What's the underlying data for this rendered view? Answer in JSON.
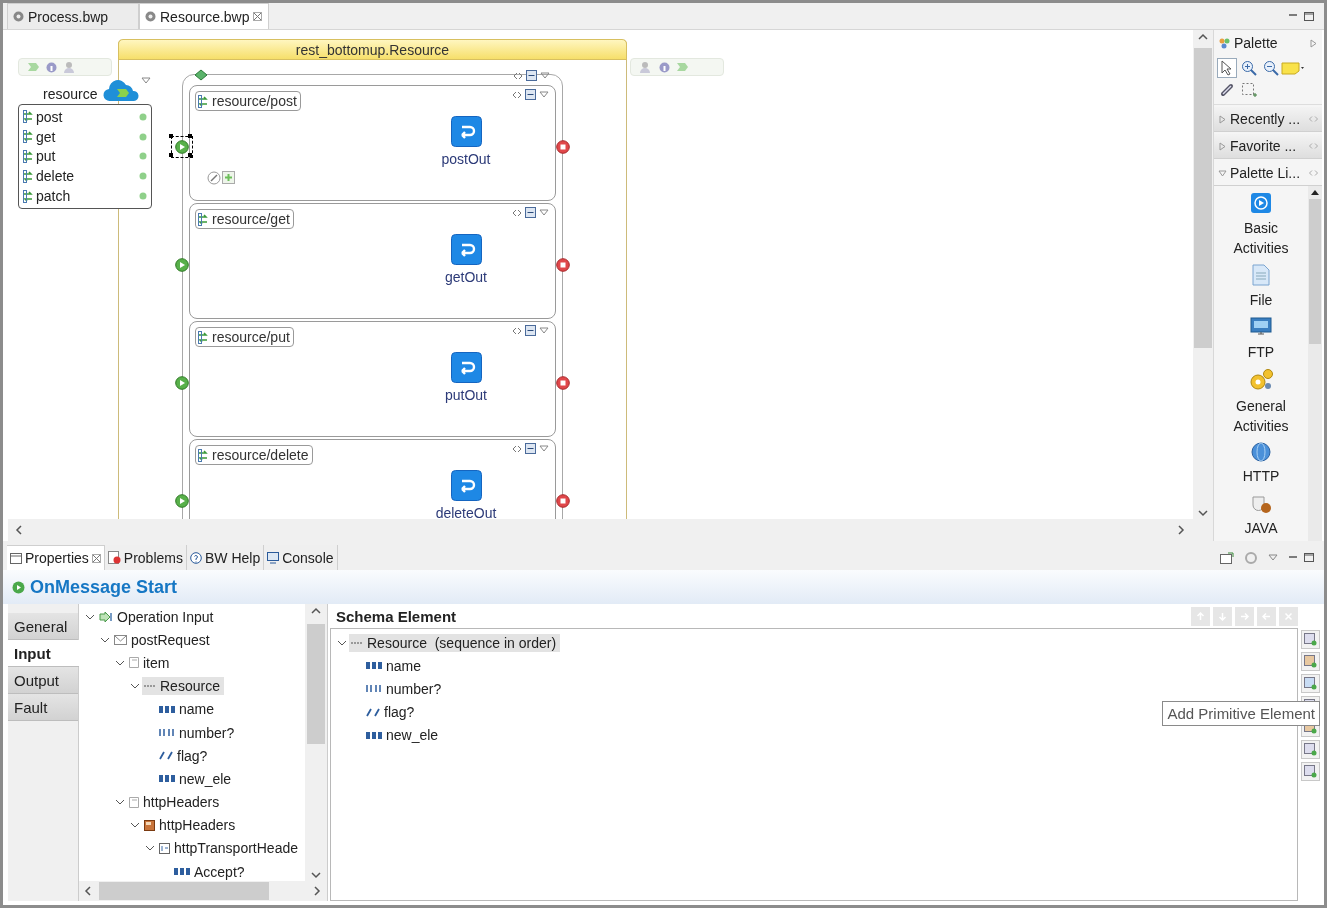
{
  "editor": {
    "tabs": [
      {
        "label": "Process.bwp",
        "selected": false,
        "closable": false
      },
      {
        "label": "Resource.bwp",
        "selected": true,
        "closable": true
      }
    ]
  },
  "canvas": {
    "resource": {
      "label": "resource",
      "operations": [
        "post",
        "get",
        "put",
        "delete",
        "patch"
      ]
    },
    "process": {
      "title": "rest_bottomup.Resource",
      "scopes": [
        {
          "label": "resource/post",
          "reply": "postOut",
          "start_selected": true
        },
        {
          "label": "resource/get",
          "reply": "getOut",
          "start_selected": false
        },
        {
          "label": "resource/put",
          "reply": "putOut",
          "start_selected": false
        },
        {
          "label": "resource/delete",
          "reply": "deleteOut",
          "start_selected": false
        }
      ]
    }
  },
  "palette": {
    "title": "Palette",
    "tools": [
      {
        "kind": "select",
        "selected": true
      },
      {
        "kind": "zoom_in",
        "selected": false
      },
      {
        "kind": "zoom_out",
        "selected": false
      },
      {
        "kind": "note",
        "selected": false
      },
      {
        "kind": "link",
        "selected": false
      },
      {
        "kind": "marquee",
        "selected": false
      }
    ],
    "drawers": [
      {
        "label": "Recently ...",
        "expanded": false
      },
      {
        "label": "Favorite ...",
        "expanded": false
      },
      {
        "label": "Palette Li...",
        "expanded": true
      }
    ],
    "items": [
      {
        "label": "Basic Activities",
        "kind": "basic"
      },
      {
        "label": "File",
        "kind": "file"
      },
      {
        "label": "FTP",
        "kind": "ftp"
      },
      {
        "label": "General Activities",
        "kind": "general"
      },
      {
        "label": "HTTP",
        "kind": "http"
      },
      {
        "label": "JAVA",
        "kind": "java"
      }
    ]
  },
  "properties": {
    "tabs": [
      {
        "label": "Properties",
        "kind": "properties",
        "selected": true,
        "closable": true
      },
      {
        "label": "Problems",
        "kind": "problems",
        "selected": false,
        "closable": false
      },
      {
        "label": "BW Help",
        "kind": "help",
        "selected": false,
        "closable": false
      },
      {
        "label": "Console",
        "kind": "console",
        "selected": false,
        "closable": false
      }
    ],
    "title": "OnMessage Start",
    "side_tabs": [
      {
        "label": "General",
        "selected": false
      },
      {
        "label": "Input",
        "selected": true
      },
      {
        "label": "Output",
        "selected": false
      },
      {
        "label": "Fault",
        "selected": false
      }
    ],
    "tree": [
      {
        "label": "Operation Input",
        "kind": "operation",
        "selected": false,
        "expanded": true,
        "children": [
          {
            "label": "postRequest",
            "kind": "message",
            "selected": false,
            "expanded": true,
            "children": [
              {
                "label": "item",
                "kind": "part",
                "selected": false,
                "expanded": true,
                "children": [
                  {
                    "label": "Resource",
                    "kind": "sequence",
                    "selected": true,
                    "expanded": true,
                    "children": [
                      {
                        "label": "name",
                        "kind": "string",
                        "selected": false
                      },
                      {
                        "label": "number?",
                        "kind": "integer",
                        "selected": false
                      },
                      {
                        "label": "flag?",
                        "kind": "boolean",
                        "selected": false
                      },
                      {
                        "label": "new_ele",
                        "kind": "string",
                        "selected": false
                      }
                    ]
                  }
                ]
              },
              {
                "label": "httpHeaders",
                "kind": "part",
                "selected": false,
                "expanded": true,
                "children": [
                  {
                    "label": "httpHeaders",
                    "kind": "complex",
                    "selected": false,
                    "expanded": true,
                    "children": [
                      {
                        "label": "httpTransportHeade",
                        "kind": "headers",
                        "selected": false,
                        "expanded": true,
                        "children": [
                          {
                            "label": "Accept?",
                            "kind": "string",
                            "selected": false
                          }
                        ]
                      }
                    ]
                  }
                ]
              }
            ]
          }
        ]
      }
    ],
    "schema": {
      "title": "Schema Element",
      "toolbar": [
        {
          "kind": "up",
          "disabled": true
        },
        {
          "kind": "down",
          "disabled": true
        },
        {
          "kind": "right",
          "disabled": true
        },
        {
          "kind": "left",
          "disabled": true
        },
        {
          "kind": "delete",
          "disabled": true
        }
      ],
      "tree": [
        {
          "label": "Resource  (sequence in order)",
          "kind": "sequence",
          "selected": true,
          "expanded": true,
          "children": [
            {
              "label": "name",
              "kind": "string",
              "selected": false
            },
            {
              "label": "number?",
              "kind": "integer",
              "selected": false
            },
            {
              "label": "flag?",
              "kind": "boolean",
              "selected": false
            },
            {
              "label": "new_ele",
              "kind": "string",
              "selected": false
            }
          ]
        }
      ]
    },
    "tooltip": "Add Primitive Element"
  }
}
